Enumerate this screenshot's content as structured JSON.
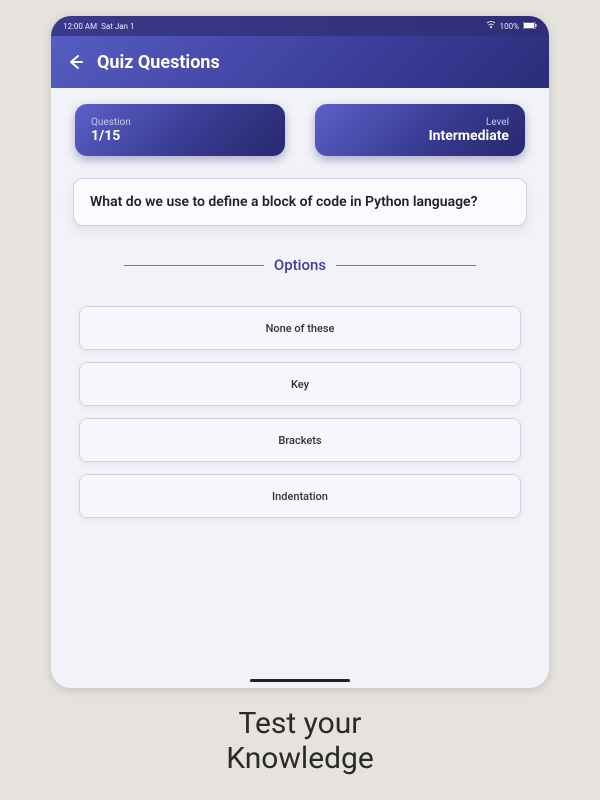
{
  "statusBar": {
    "time": "12:00 AM",
    "date": "Sat Jan 1",
    "battery": "100%"
  },
  "header": {
    "title": "Quiz Questions"
  },
  "progress": {
    "label": "Question",
    "value": "1/15"
  },
  "level": {
    "label": "Level",
    "value": "Intermediate"
  },
  "question": {
    "text": "What do we use to define a block of code in Python language?"
  },
  "optionsLabel": "Options",
  "options": [
    "None of these",
    "Key",
    "Brackets",
    "Indentation"
  ],
  "caption": {
    "line1": "Test your",
    "line2": "Knowledge"
  }
}
